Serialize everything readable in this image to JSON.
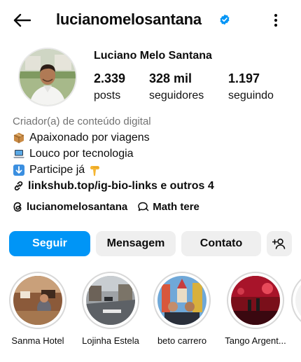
{
  "header": {
    "username": "lucianomelosantana",
    "back_icon": "arrow-left-icon",
    "verified_icon": "verified-badge-icon",
    "more_icon": "vertical-dots-icon"
  },
  "profile": {
    "full_name": "Luciano Melo Santana",
    "stats": [
      {
        "value": "2.339",
        "label": "posts"
      },
      {
        "value": "328 mil",
        "label": "seguidores"
      },
      {
        "value": "1.197",
        "label": "seguindo"
      }
    ]
  },
  "bio": {
    "category": "Criador(a) de conteúdo digital",
    "lines": [
      {
        "icon": "package-emoji",
        "text": "Apaixonado por viagens"
      },
      {
        "icon": "laptop-emoji",
        "text": "Louco por tecnologia"
      },
      {
        "icon": "down-arrow-emoji",
        "text": "Participe já",
        "trailing_icon": "pointing-down-emoji"
      }
    ],
    "link_text": "linkshub.top/ig-bio-links e outros 4"
  },
  "threads": {
    "handle": "lucianomelosantana",
    "channel": "Math tere"
  },
  "actions": {
    "follow": "Seguir",
    "message": "Mensagem",
    "contact": "Contato",
    "add_icon": "add-person-icon"
  },
  "highlights": [
    {
      "label": "Sanma Hotel"
    },
    {
      "label": "Lojinha Estela"
    },
    {
      "label": "beto carrero"
    },
    {
      "label": "Tango Argent..."
    }
  ],
  "colors": {
    "accent": "#0095f6",
    "verified": "#0095f6",
    "secondary_button": "#efefef",
    "muted_text": "#737373"
  }
}
